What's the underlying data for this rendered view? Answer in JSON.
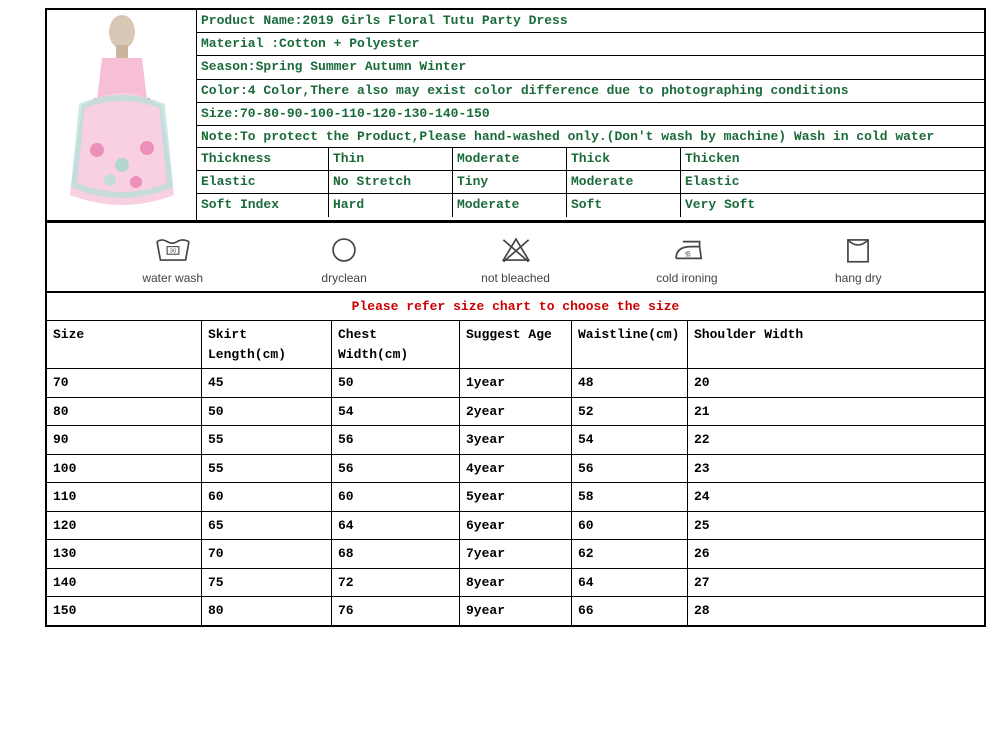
{
  "info": {
    "product_name": "Product Name:2019 Girls Floral Tutu Party Dress",
    "material": "Material :Cotton + Polyester",
    "season": "Season:Spring Summer Autumn Winter",
    "color": "Color:4 Color,There also may exist color difference due to photographing conditions",
    "size": "Size:70-80-90-100-110-120-130-140-150",
    "note": "Note:To protect the Product,Please hand-washed only.(Don't wash by machine) Wash in cold water"
  },
  "attrs": [
    [
      "Thickness",
      "Thin",
      "Moderate",
      "Thick",
      "Thicken"
    ],
    [
      "Elastic",
      "No Stretch",
      "Tiny",
      "Moderate",
      "Elastic"
    ],
    [
      "Soft Index",
      "Hard",
      "Moderate",
      "Soft",
      "Very Soft"
    ]
  ],
  "care": [
    {
      "label": "water wash"
    },
    {
      "label": "dryclean"
    },
    {
      "label": "not bleached"
    },
    {
      "label": "cold ironing"
    },
    {
      "label": "hang dry"
    }
  ],
  "size_title": "Please refer size chart to choose the size",
  "size_headers": [
    "Size",
    "Skirt Length(cm)",
    "Chest Width(cm)",
    "Suggest Age",
    "Waistline(cm)",
    "Shoulder Width"
  ],
  "size_rows": [
    [
      "70",
      "45",
      "50",
      "1year",
      "48",
      "20"
    ],
    [
      "80",
      "50",
      "54",
      "2year",
      "52",
      "21"
    ],
    [
      "90",
      "55",
      "56",
      "3year",
      "54",
      "22"
    ],
    [
      "100",
      "55",
      "56",
      "4year",
      "56",
      "23"
    ],
    [
      "110",
      "60",
      "60",
      "5year",
      "58",
      "24"
    ],
    [
      "120",
      "65",
      "64",
      "6year",
      "60",
      "25"
    ],
    [
      "130",
      "70",
      "68",
      "7year",
      "62",
      "26"
    ],
    [
      "140",
      "75",
      "72",
      "8year",
      "64",
      "27"
    ],
    [
      "150",
      "80",
      "76",
      "9year",
      "66",
      "28"
    ]
  ],
  "chart_data": {
    "type": "table",
    "title": "Size Chart",
    "columns": [
      "Size",
      "Skirt Length(cm)",
      "Chest Width(cm)",
      "Suggest Age",
      "Waistline(cm)",
      "Shoulder Width"
    ],
    "rows": [
      [
        70,
        45,
        50,
        "1year",
        48,
        20
      ],
      [
        80,
        50,
        54,
        "2year",
        52,
        21
      ],
      [
        90,
        55,
        56,
        "3year",
        54,
        22
      ],
      [
        100,
        55,
        56,
        "4year",
        56,
        23
      ],
      [
        110,
        60,
        60,
        "5year",
        58,
        24
      ],
      [
        120,
        65,
        64,
        "6year",
        60,
        25
      ],
      [
        130,
        70,
        68,
        "7year",
        62,
        26
      ],
      [
        140,
        75,
        72,
        "8year",
        64,
        27
      ],
      [
        150,
        80,
        76,
        "9year",
        66,
        28
      ]
    ]
  }
}
